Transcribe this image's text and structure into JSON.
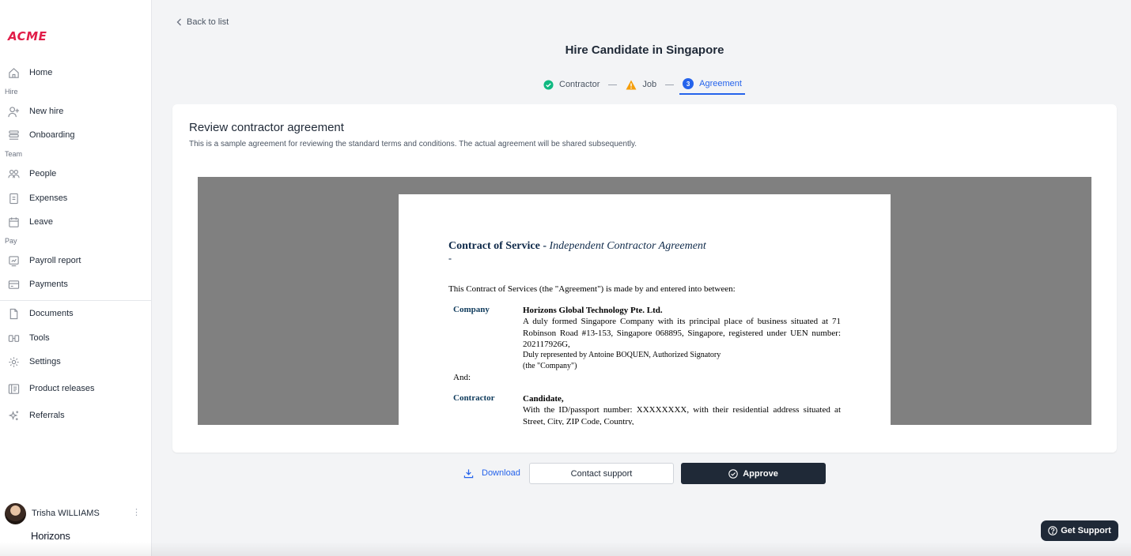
{
  "sidebar": {
    "logo": "ACME",
    "items": [
      {
        "label": "Home",
        "icon": "home-icon"
      },
      {
        "label": "New hire",
        "icon": "user-plus-icon"
      },
      {
        "label": "Onboarding",
        "icon": "stack-icon"
      },
      {
        "label": "People",
        "icon": "people-icon"
      },
      {
        "label": "Expenses",
        "icon": "receipt-icon"
      },
      {
        "label": "Leave",
        "icon": "calendar-icon"
      },
      {
        "label": "Payroll report",
        "icon": "payroll-icon"
      },
      {
        "label": "Payments",
        "icon": "card-icon"
      },
      {
        "label": "Documents",
        "icon": "document-icon"
      },
      {
        "label": "Tools",
        "icon": "tools-icon"
      },
      {
        "label": "Settings",
        "icon": "gear-icon"
      },
      {
        "label": "Product releases",
        "icon": "releases-icon"
      },
      {
        "label": "Referrals",
        "icon": "sparkle-icon"
      }
    ],
    "sections": {
      "hire": "Hire",
      "team": "Team",
      "pay": "Pay"
    },
    "user": {
      "name": "Trisha WILLIAMS",
      "company": "Horizons"
    }
  },
  "main": {
    "back_label": "Back to list",
    "title": "Hire Candidate in Singapore",
    "steps": [
      {
        "label": "Contractor",
        "status": "complete"
      },
      {
        "label": "Job",
        "status": "warning"
      },
      {
        "label": "Agreement",
        "status": "active",
        "number": "3"
      }
    ]
  },
  "card": {
    "title": "Review contractor agreement",
    "subtitle": "This is a sample agreement for reviewing the standard terms and conditions. The actual agreement will be shared subsequently."
  },
  "document": {
    "title_bold": "Contract of Service - ",
    "title_italic": "Independent Contractor Agreement",
    "dash": "-",
    "intro": "This Contract of Services (the \"Agreement\") is made by and entered into between:",
    "company_label": "Company",
    "company_name": "Horizons Global Technology Pte. Ltd.",
    "company_desc": "A duly formed Singapore Company with its principal place of business situated at 71 Robinson Road #13-153, Singapore 068895, Singapore, registered under UEN number: 202117926G,",
    "company_rep": "Duly represented by Antoine BOQUEN, Authorized Signatory",
    "company_alias": "(the \"Company\")",
    "and_label": "And:",
    "contractor_label": "Contractor",
    "contractor_name": "Candidate,",
    "contractor_desc": "With the ID/passport number: XXXXXXXX, with their residential address situated at Street, City, ZIP Code, Country,"
  },
  "actions": {
    "download": "Download",
    "contact": "Contact support",
    "approve": "Approve"
  },
  "support": {
    "label": "Get Support"
  },
  "colors": {
    "accent": "#2563eb",
    "dark": "#1f2937",
    "logo": "#e11d48",
    "success": "#10b981",
    "warning": "#f59e0b"
  }
}
